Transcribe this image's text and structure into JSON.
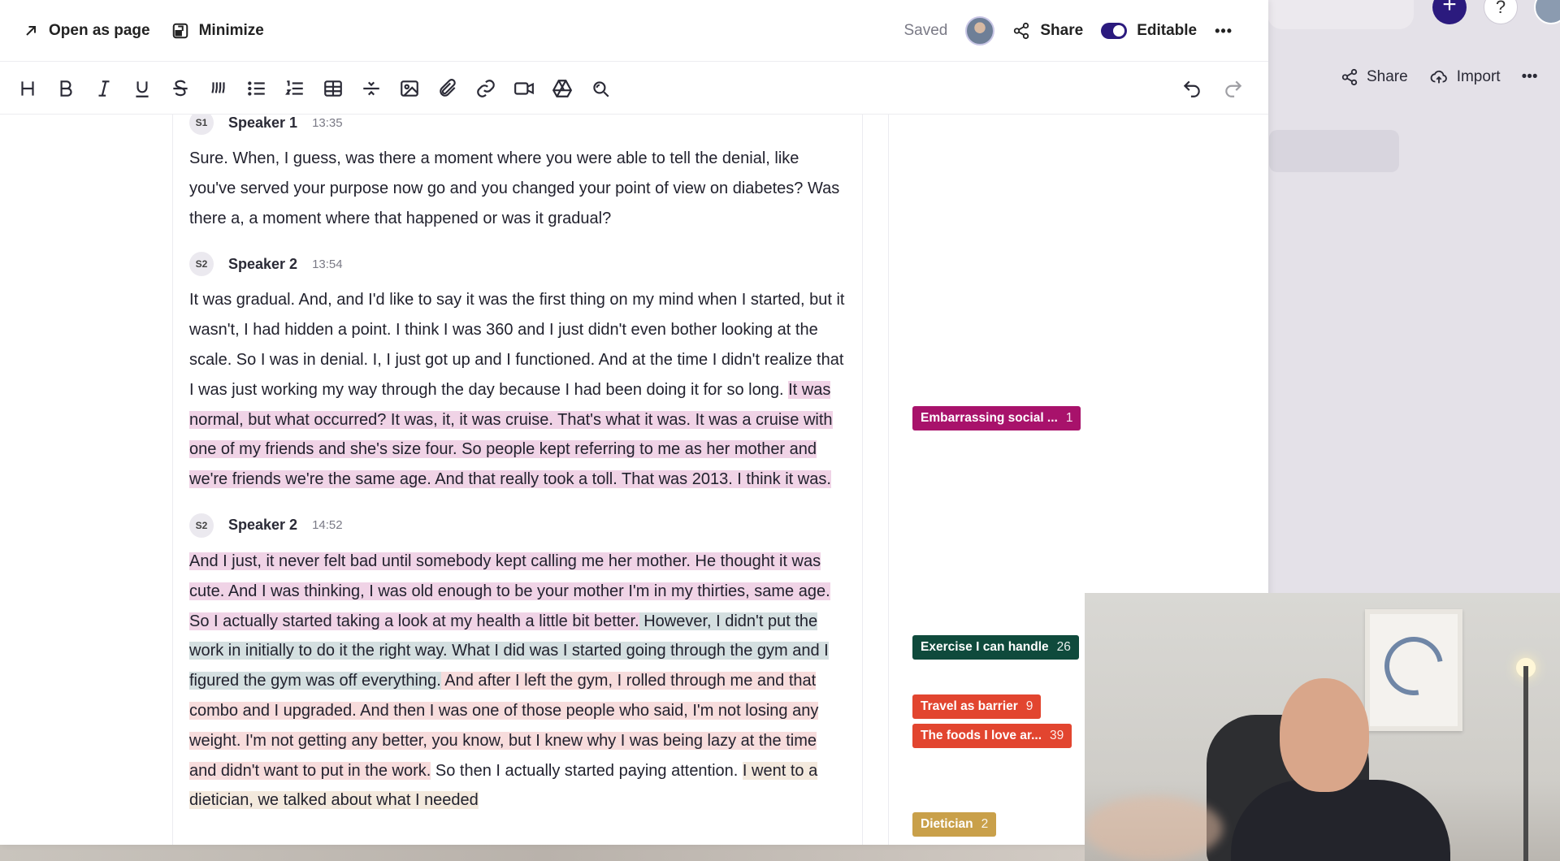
{
  "topbar": {
    "open_as_page": "Open as page",
    "minimize": "Minimize",
    "saved": "Saved",
    "share": "Share",
    "editable": "Editable"
  },
  "background": {
    "share": "Share",
    "import": "Import"
  },
  "transcript": [
    {
      "badge": "S1",
      "speaker": "Speaker 1",
      "time": "13:35",
      "segments": [
        {
          "text": "Sure. When, I guess, was there a moment where you were able to tell the denial, like you've served your purpose now go and you changed your point of view on diabetes? Was there a, a moment where that happened or was it gradual?",
          "hl": ""
        }
      ]
    },
    {
      "badge": "S2",
      "speaker": "Speaker 2",
      "time": "13:54",
      "segments": [
        {
          "text": "It was gradual. And, and I'd like to say it was the first thing on my mind when I started, but it wasn't, I had hidden a point. I think I was 360 and I just didn't even bother looking at the scale. So I was in denial. I, I just got up and I functioned. And at the time I didn't realize that I was just working my way through the day because I had been doing it for so long. ",
          "hl": ""
        },
        {
          "text": "It was normal, but what occurred? It was, it, it was cruise. That's what it was. It was a cruise with one of my friends and she's size four. So people kept referring to me as her mother and we're friends we're the same age. And that really took a toll. That was 2013. I think it was.",
          "hl": "pink"
        }
      ]
    },
    {
      "badge": "S2",
      "speaker": "Speaker 2",
      "time": "14:52",
      "segments": [
        {
          "text": "And I just, it never felt bad until somebody kept calling me her mother. He thought it was cute. And I was thinking, I was old enough to be your mother I'm in my thirties, same age. So I actually started taking a look at my health a little bit better.",
          "hl": "pink"
        },
        {
          "text": " However, I didn't put the work in initially to do it the right way. What I did was I started going through the gym and I figured the gym was off everything.",
          "hl": "green"
        },
        {
          "text": " And after I left the gym, I rolled through me and that combo and I upgraded. And then I was one of those people who said, I'm not losing any weight. I'm not getting any better, you know, but I knew why I was being lazy at the time and didn't want to put in the work.",
          "hl": "salmon"
        },
        {
          "text": " So then I actually started paying attention. ",
          "hl": ""
        },
        {
          "text": "I went to a dietician, we talked about what I needed",
          "hl": "tan"
        }
      ]
    }
  ],
  "tags": [
    {
      "label": "Embarrassing social ...",
      "count": "1",
      "color": "#a8126b"
    },
    {
      "label": "Exercise I can handle",
      "count": "26",
      "color": "#0f4a3c"
    },
    {
      "label": "Travel as barrier",
      "count": "9",
      "color": "#e2452f"
    },
    {
      "label": "The foods I love ar...",
      "count": "39",
      "color": "#e2452f"
    },
    {
      "label": "Dietician",
      "count": "2",
      "color": "#c9a04a"
    }
  ]
}
